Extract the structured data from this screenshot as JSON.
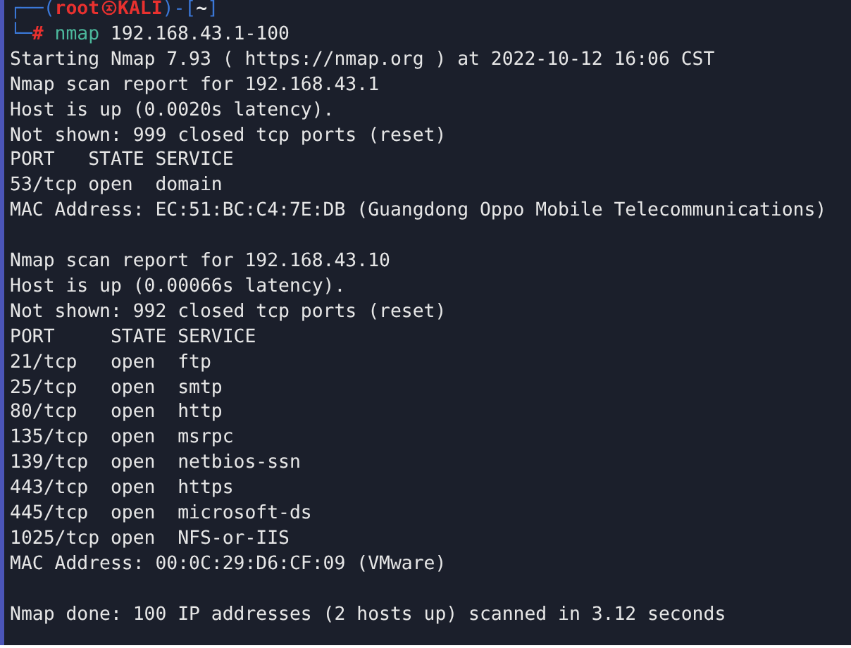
{
  "prompt": {
    "line1": [
      {
        "text": "┌──(",
        "kind": "frame"
      },
      {
        "text": "root",
        "kind": "user"
      },
      {
        "kind": "symbol"
      },
      {
        "text": "KALI",
        "kind": "user"
      },
      {
        "text": ")-[",
        "kind": "frame"
      },
      {
        "text": "~",
        "kind": "path"
      },
      {
        "text": "]",
        "kind": "frame"
      }
    ],
    "line2": [
      {
        "text": "└─",
        "kind": "frame"
      },
      {
        "text": "#",
        "kind": "user"
      },
      {
        "text": "nmap",
        "kind": "command"
      },
      {
        "text": "192.168.43.1-100",
        "kind": "arg"
      }
    ]
  },
  "output": [
    {
      "lines": [
        "Starting Nmap 7.93 ( https://nmap.org ) at 2022-10-12 16:06 CST",
        "Nmap scan report for 192.168.43.1",
        "Host is up (0.0020s latency).",
        "Not shown: 999 closed tcp ports (reset)",
        "PORT   STATE SERVICE",
        "53/tcp open  domain",
        "MAC Address: EC:51:BC:C4:7E:DB (Guangdong Oppo Mobile Telecommunications)"
      ]
    },
    {
      "lines": [
        "Nmap scan report for 192.168.43.10",
        "Host is up (0.00066s latency).",
        "Not shown: 992 closed tcp ports (reset)",
        "PORT     STATE SERVICE",
        "21/tcp   open  ftp",
        "25/tcp   open  smtp",
        "80/tcp   open  http",
        "135/tcp  open  msrpc",
        "139/tcp  open  netbios-ssn",
        "443/tcp  open  https",
        "445/tcp  open  microsoft-ds",
        "1025/tcp open  NFS-or-IIS",
        "MAC Address: 00:0C:29:D6:CF:09 (VMware)"
      ]
    },
    {
      "lines": [
        "Nmap done: 100 IP addresses (2 hosts up) scanned in 3.12 seconds"
      ]
    }
  ]
}
